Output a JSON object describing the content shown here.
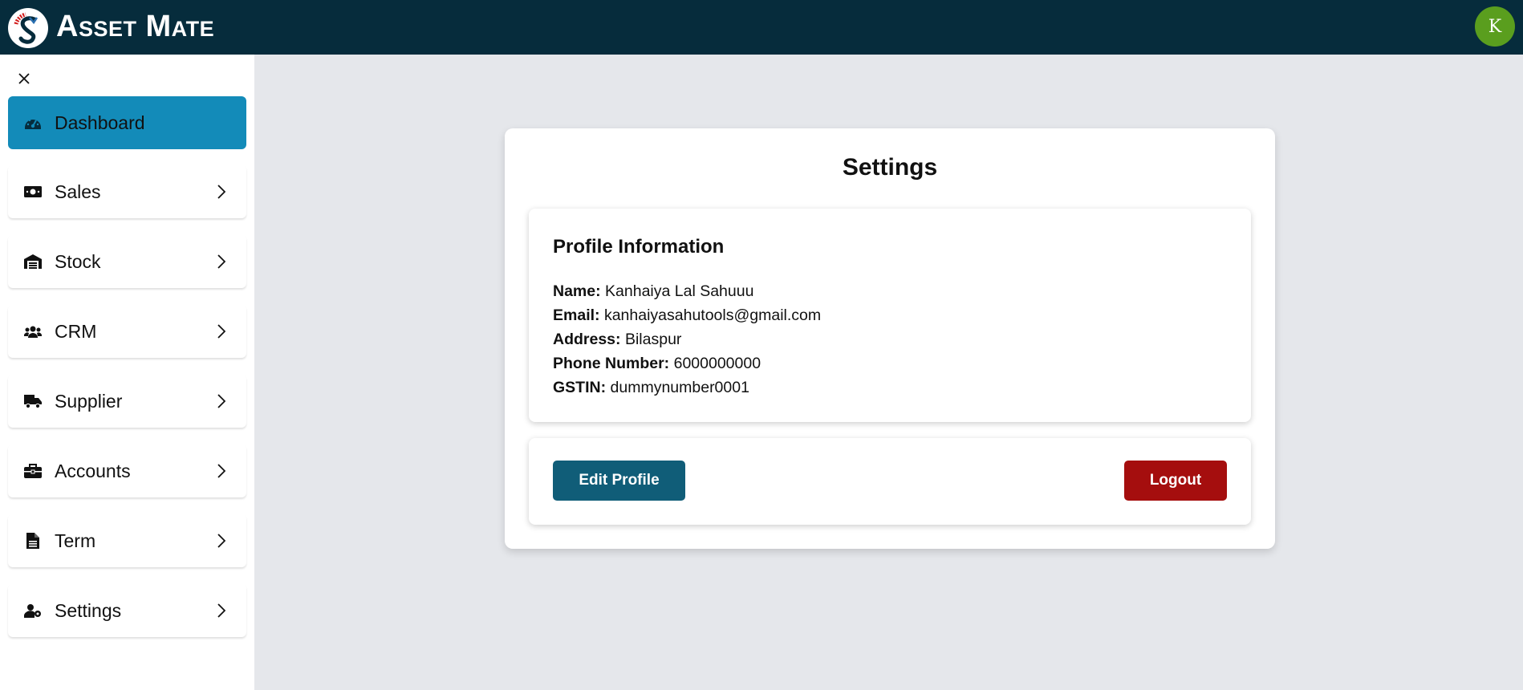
{
  "header": {
    "brand": "Asset Mate",
    "avatar_initial": "K",
    "colors": {
      "bar": "#062c3c",
      "avatar": "#5a9e1e"
    }
  },
  "sidebar": {
    "close_icon": "close-icon",
    "items": [
      {
        "label": "Dashboard",
        "icon": "dashboard-gauge-icon",
        "active": true,
        "has_chevron": false
      },
      {
        "label": "Sales",
        "icon": "money-bill-icon",
        "active": false,
        "has_chevron": true
      },
      {
        "label": "Stock",
        "icon": "warehouse-icon",
        "active": false,
        "has_chevron": true
      },
      {
        "label": "CRM",
        "icon": "users-icon",
        "active": false,
        "has_chevron": true
      },
      {
        "label": "Supplier",
        "icon": "truck-icon",
        "active": false,
        "has_chevron": true
      },
      {
        "label": "Accounts",
        "icon": "briefcase-icon",
        "active": false,
        "has_chevron": true
      },
      {
        "label": "Term",
        "icon": "document-icon",
        "active": false,
        "has_chevron": true
      },
      {
        "label": "Settings",
        "icon": "user-gear-icon",
        "active": false,
        "has_chevron": true
      }
    ],
    "active_color": "#138bb9"
  },
  "main": {
    "title": "Settings",
    "profile": {
      "heading": "Profile Information",
      "fields": [
        {
          "label": "Name:",
          "value": "Kanhaiya Lal Sahuuu"
        },
        {
          "label": "Email:",
          "value": "kanhaiyasahutools@gmail.com"
        },
        {
          "label": "Address:",
          "value": "Bilaspur"
        },
        {
          "label": "Phone Number:",
          "value": "6000000000"
        },
        {
          "label": "GSTIN:",
          "value": "dummynumber0001"
        }
      ]
    },
    "actions": {
      "edit_label": "Edit Profile",
      "logout_label": "Logout",
      "edit_color": "#105d78",
      "logout_color": "#a50e0e"
    }
  }
}
